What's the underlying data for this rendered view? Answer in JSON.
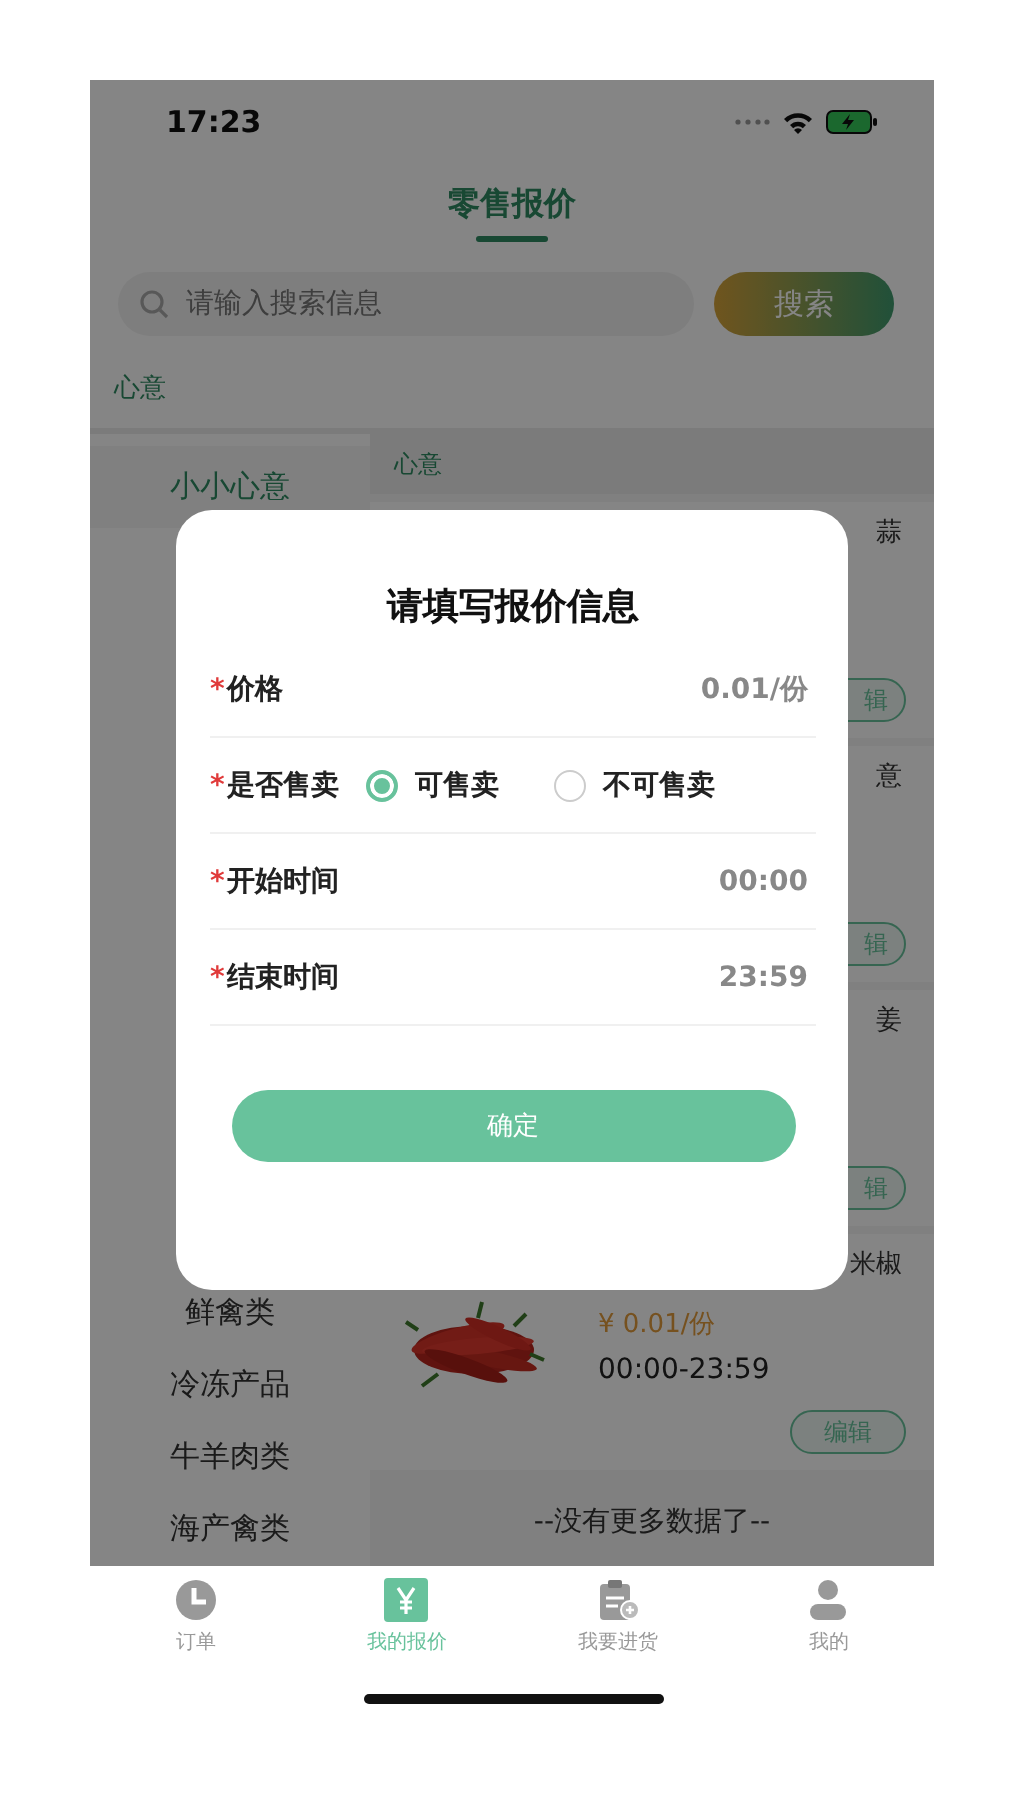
{
  "status_bar": {
    "time": "17:23"
  },
  "header": {
    "title": "零售报价"
  },
  "search": {
    "placeholder": "请输入搜索信息",
    "button": "搜索"
  },
  "breadcrumb": "心意",
  "sidebar": {
    "items": [
      {
        "label": "小小心意",
        "selected": true
      },
      {
        "label": "鲜禽类",
        "selected": false
      },
      {
        "label": "冷冻产品",
        "selected": false
      },
      {
        "label": "牛羊肉类",
        "selected": false
      },
      {
        "label": "海产禽类",
        "selected": false
      }
    ]
  },
  "content": {
    "section": "心意",
    "products": [
      {
        "kind": "covered",
        "name": "蒜",
        "button": "辑"
      },
      {
        "kind": "covered",
        "name": "意",
        "button": "辑"
      },
      {
        "kind": "covered",
        "name": "姜",
        "button": "辑"
      },
      {
        "kind": "full",
        "name": "米椒",
        "price": "¥ 0.01/份",
        "time": "00:00-23:59",
        "button": "编辑"
      }
    ],
    "end_note": "--没有更多数据了--"
  },
  "modal": {
    "title": "请填写报价信息",
    "fields": [
      {
        "kind": "text",
        "mark": "*",
        "label": "价格",
        "value": "0.01/份"
      },
      {
        "kind": "radio",
        "mark": "*",
        "label": "是否售卖",
        "options": [
          {
            "label": "可售卖",
            "selected": true
          },
          {
            "label": "不可售卖",
            "selected": false
          }
        ]
      },
      {
        "kind": "text",
        "mark": "*",
        "label": "开始时间",
        "value": "00:00"
      },
      {
        "kind": "text",
        "mark": "*",
        "label": "结束时间",
        "value": "23:59"
      }
    ],
    "confirm": "确定"
  },
  "tabs": [
    {
      "label": "订单",
      "selected": false
    },
    {
      "label": "我的报价",
      "selected": true
    },
    {
      "label": "我要进货",
      "selected": false
    },
    {
      "label": "我的",
      "selected": false
    }
  ]
}
